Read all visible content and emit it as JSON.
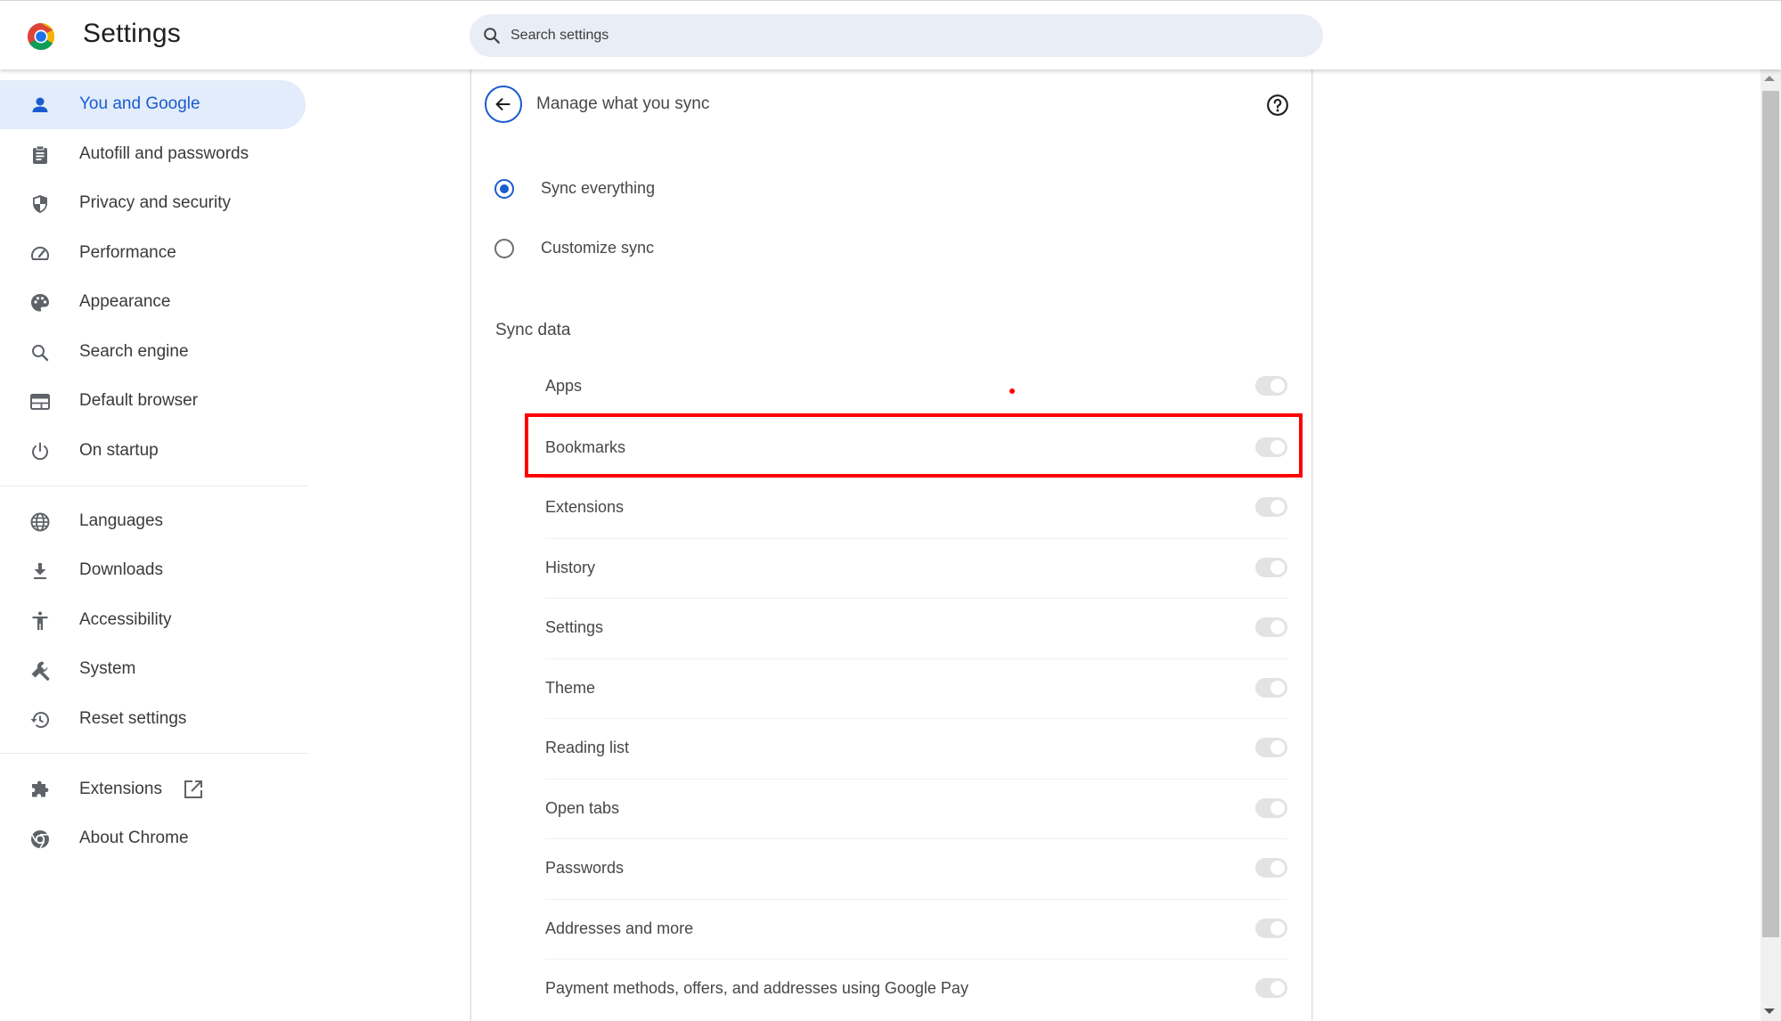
{
  "header": {
    "app_title": "Settings",
    "logo_icon": "chrome-logo",
    "search": {
      "placeholder": "Search settings",
      "value": "",
      "icon": "search-icon"
    }
  },
  "sidebar": {
    "items": [
      {
        "label": "You and Google",
        "icon": "person-icon",
        "active": true
      },
      {
        "label": "Autofill and passwords",
        "icon": "clipboard-icon",
        "active": false
      },
      {
        "label": "Privacy and security",
        "icon": "shield-icon",
        "active": false
      },
      {
        "label": "Performance",
        "icon": "speedometer-icon",
        "active": false
      },
      {
        "label": "Appearance",
        "icon": "palette-icon",
        "active": false
      },
      {
        "label": "Search engine",
        "icon": "search-icon",
        "active": false
      },
      {
        "label": "Default browser",
        "icon": "browser-window-icon",
        "active": false
      },
      {
        "label": "On startup",
        "icon": "power-icon",
        "active": false
      },
      {
        "label": "Languages",
        "icon": "globe-icon",
        "active": false
      },
      {
        "label": "Downloads",
        "icon": "download-icon",
        "active": false
      },
      {
        "label": "Accessibility",
        "icon": "accessibility-icon",
        "active": false
      },
      {
        "label": "System",
        "icon": "wrench-icon",
        "active": false
      },
      {
        "label": "Reset settings",
        "icon": "history-reset-icon",
        "active": false
      },
      {
        "label": "Extensions",
        "icon": "puzzle-icon",
        "active": false,
        "external": true
      },
      {
        "label": "About Chrome",
        "icon": "chrome-outline-icon",
        "active": false
      }
    ]
  },
  "main": {
    "title": "Manage what you sync",
    "back_icon": "arrow-back-icon",
    "help_icon": "help-circle-icon",
    "sync_options": [
      {
        "label": "Sync everything",
        "checked": true
      },
      {
        "label": "Customize sync",
        "checked": false
      }
    ],
    "section_title": "Sync data",
    "sync_items": [
      {
        "label": "Apps",
        "enabled": true,
        "disabled_look": true
      },
      {
        "label": "Bookmarks",
        "enabled": true,
        "disabled_look": true,
        "highlighted": true
      },
      {
        "label": "Extensions",
        "enabled": true,
        "disabled_look": true
      },
      {
        "label": "History",
        "enabled": true,
        "disabled_look": true
      },
      {
        "label": "Settings",
        "enabled": true,
        "disabled_look": true
      },
      {
        "label": "Theme",
        "enabled": true,
        "disabled_look": true
      },
      {
        "label": "Reading list",
        "enabled": true,
        "disabled_look": true
      },
      {
        "label": "Open tabs",
        "enabled": true,
        "disabled_look": true
      },
      {
        "label": "Passwords",
        "enabled": true,
        "disabled_look": true
      },
      {
        "label": "Addresses and more",
        "enabled": true,
        "disabled_look": true
      },
      {
        "label": "Payment methods, offers, and addresses using Google Pay",
        "enabled": true,
        "disabled_look": true
      }
    ]
  },
  "annotation": {
    "highlight_color": "#ff0000",
    "highlight_target": "Bookmarks"
  },
  "colors": {
    "accent": "#1a5ccf",
    "active_bg": "#e3ecfb",
    "search_bg": "#e9eef6",
    "toggle_off_track": "#e3e3e3"
  }
}
